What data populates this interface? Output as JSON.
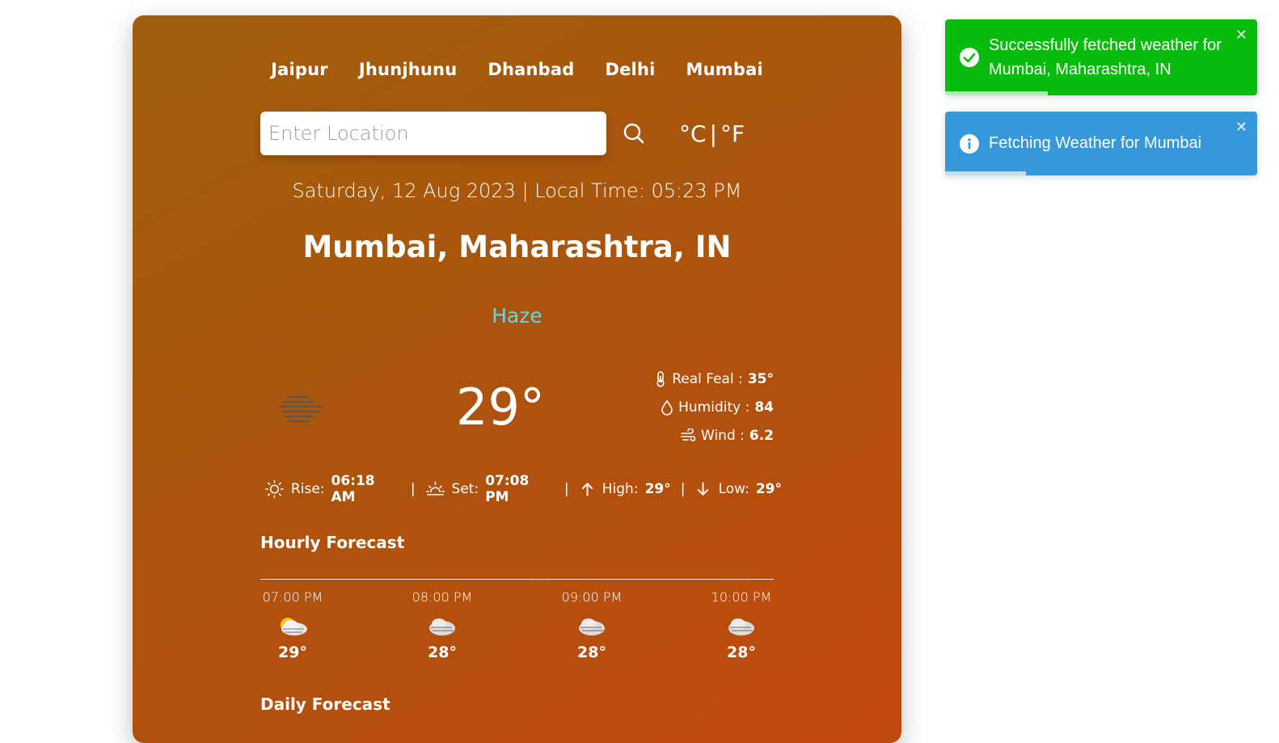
{
  "cities": [
    "Jaipur",
    "Jhunjhunu",
    "Dhanbad",
    "Delhi",
    "Mumbai"
  ],
  "search": {
    "placeholder": "Enter Location",
    "value": ""
  },
  "units": {
    "celsius": "°C",
    "separator": "|",
    "fahrenheit": "°F"
  },
  "date_line": "Saturday, 12 Aug 2023 | Local Time: 05:23 PM",
  "location": "Mumbai, Maharashtra, IN",
  "condition": "Haze",
  "condition_color": "#67d6e8",
  "temperature": "29°",
  "details": {
    "real_feel_label": "Real Feal :",
    "real_feel_value": "35°",
    "humidity_label": "Humidity :",
    "humidity_value": "84",
    "wind_label": "Wind :",
    "wind_value": "6.2"
  },
  "sun": {
    "rise_label": "Rise:",
    "rise_value": "06:18 AM",
    "set_label": "Set:",
    "set_value": "07:08 PM",
    "high_label": "High:",
    "high_value": "29°",
    "low_label": "Low:",
    "low_value": "29°",
    "separator": "|"
  },
  "hourly_title": "Hourly Forecast",
  "hourly": [
    {
      "time": "07:00 PM",
      "temp": "29°",
      "icon": "partly-cloudy-icon"
    },
    {
      "time": "08:00 PM",
      "temp": "28°",
      "icon": "cloudy-icon"
    },
    {
      "time": "09:00 PM",
      "temp": "28°",
      "icon": "cloudy-icon"
    },
    {
      "time": "10:00 PM",
      "temp": "28°",
      "icon": "cloudy-icon"
    }
  ],
  "daily_title": "Daily Forecast",
  "toasts": {
    "success": {
      "text": "Successfully fetched weather for Mumbai, Maharashtra, IN",
      "color": "#07bc0c",
      "progress": 0.33
    },
    "info": {
      "text": "Fetching Weather for Mumbai",
      "color": "#3498db",
      "progress": 0.26
    }
  }
}
